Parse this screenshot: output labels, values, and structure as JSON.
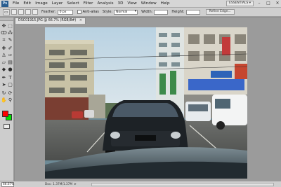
{
  "app": {
    "logo": "Ps"
  },
  "menu": {
    "items": [
      "File",
      "Edit",
      "Image",
      "Layer",
      "Select",
      "Filter",
      "Analysis",
      "3D",
      "View",
      "Window",
      "Help"
    ],
    "workspace": "ESSENTIALS ▾",
    "window_controls": {
      "minimize": "–",
      "restore": "□",
      "close": "✕"
    }
  },
  "options": {
    "tool_glyph": "▭",
    "feather_label": "Feather:",
    "feather_value": "0 px",
    "antialias_label": "Anti-alias",
    "style_label": "Style:",
    "style_value": "Normal",
    "width_label": "Width:",
    "height_label": "Height:",
    "refine_edge": "Refine Edge..."
  },
  "document": {
    "tab_title": "DSC01915.JPG @ 66.7% (RGB/8#)",
    "close": "×"
  },
  "colors": {
    "foreground": "#ff0000",
    "background": "#00e000"
  },
  "status": {
    "zoom": "66.67%",
    "doc_info": "Doc: 1.37M/1.37M",
    "arrow": "▸"
  }
}
